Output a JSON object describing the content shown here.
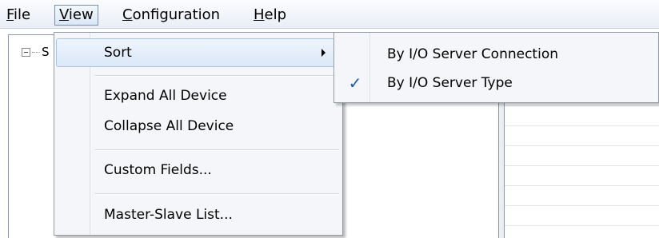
{
  "menubar": {
    "items": [
      {
        "label": "File",
        "accel": "F",
        "rest": "ile"
      },
      {
        "label": "View",
        "accel": "V",
        "rest": "iew"
      },
      {
        "label": "Configuration",
        "accel": "C",
        "rest": "onfiguration"
      },
      {
        "label": "Help",
        "accel": "H",
        "rest": "elp"
      }
    ]
  },
  "tree": {
    "root_label": "S"
  },
  "view_menu": {
    "items": [
      {
        "label": "Sort",
        "has_submenu": true
      },
      {
        "label": "Expand All Device"
      },
      {
        "label": "Collapse All Device"
      },
      {
        "label": "Custom Fields..."
      },
      {
        "label": "Master-Slave List..."
      }
    ]
  },
  "sort_submenu": {
    "items": [
      {
        "label": "By I/O Server Connection",
        "checked": false
      },
      {
        "label": "By I/O Server Type",
        "checked": true
      }
    ],
    "check_glyph": "✓"
  },
  "icons": {
    "tree_toggle": "collapse-box-icon",
    "submenu_arrow": "chevron-right-icon",
    "check": "checkmark-icon"
  },
  "colors": {
    "accent_check": "#1a5bb0",
    "hover_border": "#a9c3e3"
  }
}
